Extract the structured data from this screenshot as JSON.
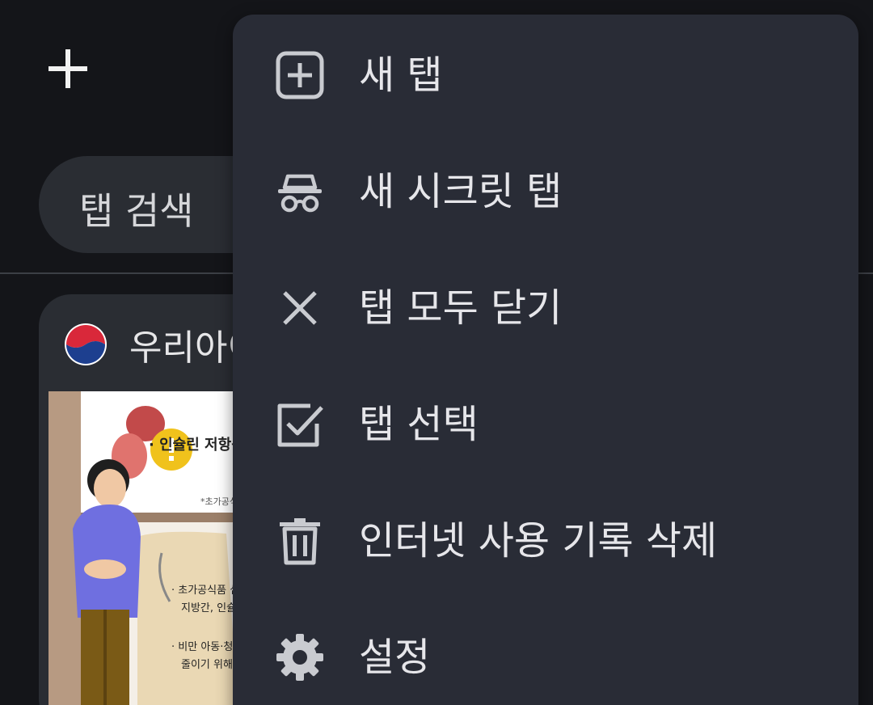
{
  "search": {
    "label": "탭 검색"
  },
  "tab_card": {
    "title": "우리아이",
    "thumbnail": {
      "bullet1": "· 인슐린 저항성 증",
      "footnote": "*초가공식품",
      "bullet2_line1": "· 초가공식품 섭",
      "bullet2_line2": "지방간, 인슐",
      "bullet3_line1": "· 비만 아동·청소",
      "bullet3_line2": "줄이기 위해서"
    }
  },
  "menu": {
    "items": [
      {
        "label": "새 탭",
        "icon": "add-box-icon"
      },
      {
        "label": "새 시크릿 탭",
        "icon": "incognito-icon"
      },
      {
        "label": "탭 모두 닫기",
        "icon": "close-icon"
      },
      {
        "label": "탭 선택",
        "icon": "checkbox-icon"
      },
      {
        "label": "인터넷 사용 기록 삭제",
        "icon": "trash-icon"
      },
      {
        "label": "설정",
        "icon": "gear-icon"
      }
    ]
  },
  "colors": {
    "background": "#141519",
    "menu_bg": "#292c36",
    "surface": "#2a2d33",
    "text": "#e6e6ea"
  }
}
